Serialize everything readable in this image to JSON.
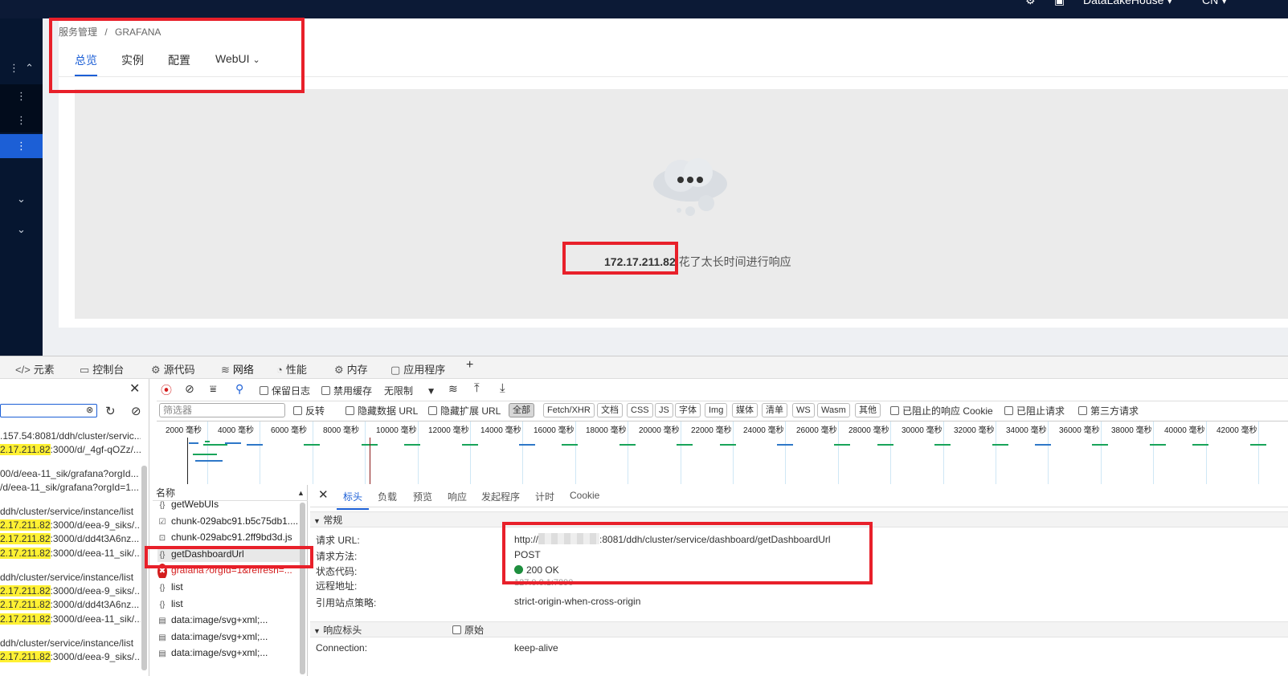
{
  "topbar": {
    "user": "DataLakeHouse",
    "lang": "CN"
  },
  "breadcrumb": {
    "root": "服务管理",
    "sep": "/",
    "current": "GRAFANA"
  },
  "tabs": {
    "overview": "总览",
    "instances": "实例",
    "config": "配置",
    "webui": "WebUI"
  },
  "error": {
    "host": "172.17.211.82",
    "message": " 花了太长时间进行响应"
  },
  "devtools": {
    "tabs": {
      "elements": "元素",
      "console": "控制台",
      "sources": "源代码",
      "network": "网络",
      "performance": "性能",
      "memory": "内存",
      "application": "应用程序"
    },
    "toolbar": {
      "preserve_log": "保留日志",
      "disable_cache": "禁用缓存",
      "throttle": "无限制"
    },
    "filter": {
      "placeholder": "筛选器",
      "invert": "反转",
      "hide_data_url": "隐藏数据 URL",
      "hide_ext_url": "隐藏扩展 URL",
      "types": [
        "全部",
        "Fetch/XHR",
        "文档",
        "CSS",
        "JS",
        "字体",
        "Img",
        "媒体",
        "清单",
        "WS",
        "Wasm",
        "其他"
      ],
      "blocked_cookies": "已阻止的响应 Cookie",
      "blocked_requests": "已阻止请求",
      "third_party": "第三方请求"
    },
    "timeline_ticks": [
      "2000 毫秒",
      "4000 毫秒",
      "6000 毫秒",
      "8000 毫秒",
      "10000 毫秒",
      "12000 毫秒",
      "14000 毫秒",
      "16000 毫秒",
      "18000 毫秒",
      "20000 毫秒",
      "22000 毫秒",
      "24000 毫秒",
      "26000 毫秒",
      "28000 毫秒",
      "30000 毫秒",
      "32000 毫秒",
      "34000 毫秒",
      "36000 毫秒",
      "38000 毫秒",
      "40000 毫秒",
      "42000 毫秒"
    ],
    "left_list": [
      {
        "pre": "",
        "hl": "",
        "post": ".157.54:8081/ddh/cluster/servic..."
      },
      {
        "pre": "",
        "hl": "2.17.211.82",
        "post": ":3000/d/_4gf-qOZz/..."
      },
      {
        "pre": "",
        "hl": "",
        "post": "00/d/eea-11_sik/grafana?orgId..."
      },
      {
        "pre": "",
        "hl": "",
        "post": "/d/eea-11_sik/grafana?orgId=1..."
      },
      {
        "pre": "",
        "hl": "",
        "post": "ddh/cluster/service/instance/list"
      },
      {
        "pre": "",
        "hl": "2.17.211.82",
        "post": ":3000/d/eea-9_siks/..."
      },
      {
        "pre": "",
        "hl": "2.17.211.82",
        "post": ":3000/d/dd4t3A6nz..."
      },
      {
        "pre": "",
        "hl": "2.17.211.82",
        "post": ":3000/d/eea-11_sik/..."
      },
      {
        "pre": "",
        "hl": "",
        "post": "ddh/cluster/service/instance/list"
      },
      {
        "pre": "",
        "hl": "2.17.211.82",
        "post": ":3000/d/eea-9_siks/..."
      },
      {
        "pre": "",
        "hl": "2.17.211.82",
        "post": ":3000/d/dd4t3A6nz..."
      },
      {
        "pre": "",
        "hl": "2.17.211.82",
        "post": ":3000/d/eea-11_sik/..."
      },
      {
        "pre": "",
        "hl": "",
        "post": "ddh/cluster/service/instance/list"
      },
      {
        "pre": "",
        "hl": "2.17.211.82",
        "post": ":3000/d/eea-9_siks/..."
      }
    ],
    "name_header": "名称",
    "requests": [
      {
        "icon": "{}",
        "name": "getWebUIs",
        "cls": ""
      },
      {
        "icon": "☑",
        "name": "chunk-029abc91.b5c75db1....",
        "cls": ""
      },
      {
        "icon": "⊡",
        "name": "chunk-029abc91.2ff9bd3d.js",
        "cls": ""
      },
      {
        "icon": "{}",
        "name": "getDashboardUrl",
        "cls": "sel"
      },
      {
        "icon": "✖",
        "name": "grafana?orgId=1&refresh=...",
        "cls": "err"
      },
      {
        "icon": "{}",
        "name": "list",
        "cls": ""
      },
      {
        "icon": "{}",
        "name": "list",
        "cls": ""
      },
      {
        "icon": "▤",
        "name": "data:image/svg+xml;...",
        "cls": ""
      },
      {
        "icon": "▤",
        "name": "data:image/svg+xml;...",
        "cls": ""
      },
      {
        "icon": "▤",
        "name": "data:image/svg+xml;...",
        "cls": ""
      }
    ],
    "detail_tabs": [
      "标头",
      "负载",
      "预览",
      "响应",
      "发起程序",
      "计时",
      "Cookie"
    ],
    "general": {
      "title": "常规",
      "url_label": "请求 URL:",
      "url_prefix": "http://",
      "url_rest": ":8081/ddh/cluster/service/dashboard/getDashboardUrl",
      "method_label": "请求方法:",
      "method": "POST",
      "status_label": "状态代码:",
      "status": "200 OK",
      "remote_label": "远程地址:",
      "remote": "127.0.0.1:7890",
      "referrer_label": "引用站点策略:",
      "referrer": "strict-origin-when-cross-origin"
    },
    "response_headers": {
      "title": "响应标头",
      "raw": "原始",
      "conn_label": "Connection:",
      "conn": "keep-alive"
    }
  }
}
